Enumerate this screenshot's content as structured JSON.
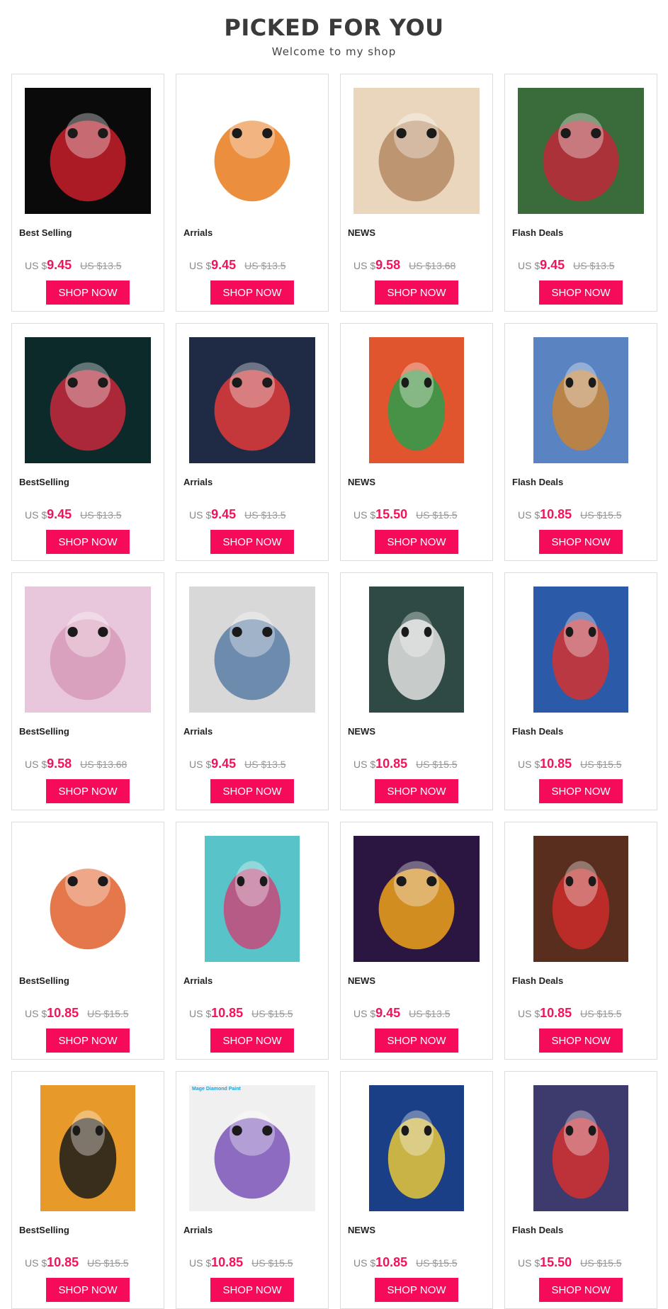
{
  "header": {
    "title": "PICKED FOR YOU",
    "subtitle": "Welcome to my shop"
  },
  "products": [
    {
      "category": "Best Selling",
      "currency": "US $",
      "price": "9.45",
      "old_price": "US $13.5",
      "button": "SHOP NOW",
      "image": "sugar-skull-elephant",
      "bg": "#0a0a0a",
      "accent": "#c81e2a",
      "portrait": false
    },
    {
      "category": "Arrials",
      "currency": "US $",
      "price": "9.45",
      "old_price": "US $13.5",
      "button": "SHOP NOW",
      "image": "halloween-black-cat-pumpkins",
      "bg": "#ffffff",
      "accent": "#e77a1c",
      "portrait": false
    },
    {
      "category": "NEWS",
      "currency": "US $",
      "price": "9.58",
      "old_price": "US $13.68",
      "button": "SHOP NOW",
      "image": "four-cat-faces",
      "bg": "#e9d6bd",
      "accent": "#b58a63",
      "portrait": false
    },
    {
      "category": "Flash Deals",
      "currency": "US $",
      "price": "9.45",
      "old_price": "US $13.5",
      "button": "SHOP NOW",
      "image": "teddy-bear-christmas-wreath",
      "bg": "#3a6b3a",
      "accent": "#c0283a",
      "portrait": false
    },
    {
      "category": "BestSelling",
      "currency": "US $",
      "price": "9.45",
      "old_price": "US $13.5",
      "button": "SHOP NOW",
      "image": "snowman-with-hat",
      "bg": "#0d2a2a",
      "accent": "#c8283c",
      "portrait": false
    },
    {
      "category": "Arrials",
      "currency": "US $",
      "price": "9.45",
      "old_price": "US $13.5",
      "button": "SHOP NOW",
      "image": "teddy-in-teacup",
      "bg": "#1f2a44",
      "accent": "#e23b3b",
      "portrait": false
    },
    {
      "category": "NEWS",
      "currency": "US $",
      "price": "15.50",
      "old_price": "US $15.5",
      "button": "SHOP NOW",
      "image": "monkey-with-glasses",
      "bg": "#e0542e",
      "accent": "#2a9d4a",
      "portrait": true
    },
    {
      "category": "Flash Deals",
      "currency": "US $",
      "price": "10.85",
      "old_price": "US $15.5",
      "button": "SHOP NOW",
      "image": "puppy-and-kitten",
      "bg": "#5a83c2",
      "accent": "#c98433",
      "portrait": true
    },
    {
      "category": "BestSelling",
      "currency": "US $",
      "price": "9.58",
      "old_price": "US $13.68",
      "button": "SHOP NOW",
      "image": "penguins-heart",
      "bg": "#e8c7dc",
      "accent": "#d79ab8",
      "portrait": false
    },
    {
      "category": "Arrials",
      "currency": "US $",
      "price": "9.45",
      "old_price": "US $13.5",
      "button": "SHOP NOW",
      "image": "cool-gorilla",
      "bg": "#d8d8d8",
      "accent": "#5b7ea6",
      "portrait": false
    },
    {
      "category": "NEWS",
      "currency": "US $",
      "price": "10.85",
      "old_price": "US $15.5",
      "button": "SHOP NOW",
      "image": "cat-dandelions",
      "bg": "#2f4a44",
      "accent": "#e2e2e2",
      "portrait": true
    },
    {
      "category": "Flash Deals",
      "currency": "US $",
      "price": "10.85",
      "old_price": "US $15.5",
      "button": "SHOP NOW",
      "image": "reindeer-santa-penguin",
      "bg": "#2b5aa8",
      "accent": "#d4322f",
      "portrait": true
    },
    {
      "category": "BestSelling",
      "currency": "US $",
      "price": "10.85",
      "old_price": "US $15.5",
      "button": "SHOP NOW",
      "image": "red-panda",
      "bg": "#ffffff",
      "accent": "#e0602a",
      "portrait": false
    },
    {
      "category": "Arrials",
      "currency": "US $",
      "price": "10.85",
      "old_price": "US $15.5",
      "button": "SHOP NOW",
      "image": "floral-cow",
      "bg": "#58c3c8",
      "accent": "#c7497a",
      "portrait": true
    },
    {
      "category": "NEWS",
      "currency": "US $",
      "price": "9.45",
      "old_price": "US $13.5",
      "button": "SHOP NOW",
      "image": "owl-reading",
      "bg": "#2a1640",
      "accent": "#f0a21c",
      "portrait": false
    },
    {
      "category": "Flash Deals",
      "currency": "US $",
      "price": "10.85",
      "old_price": "US $15.5",
      "button": "SHOP NOW",
      "image": "gnome-lantern",
      "bg": "#5a2e1e",
      "accent": "#cc2a2a",
      "portrait": true
    },
    {
      "category": "BestSelling",
      "currency": "US $",
      "price": "10.85",
      "old_price": "US $15.5",
      "button": "SHOP NOW",
      "image": "halloween-ghost",
      "bg": "#e79a2a",
      "accent": "#1a1a1a",
      "portrait": true
    },
    {
      "category": "Arrials",
      "currency": "US $",
      "price": "10.85",
      "old_price": "US $15.5",
      "button": "SHOP NOW",
      "image": "colorful-owls",
      "bg": "#f0f0f0",
      "accent": "#7b54b8",
      "portrait": false,
      "overlay_text": "Mage Diamond Paint"
    },
    {
      "category": "NEWS",
      "currency": "US $",
      "price": "10.85",
      "old_price": "US $15.5",
      "button": "SHOP NOW",
      "image": "starry-night-black-cat",
      "bg": "#1b3f86",
      "accent": "#e8c83a",
      "portrait": true
    },
    {
      "category": "Flash Deals",
      "currency": "US $",
      "price": "15.50",
      "old_price": "US $15.5",
      "button": "SHOP NOW",
      "image": "witch-cat",
      "bg": "#3d3a6e",
      "accent": "#d43030",
      "portrait": true
    }
  ]
}
